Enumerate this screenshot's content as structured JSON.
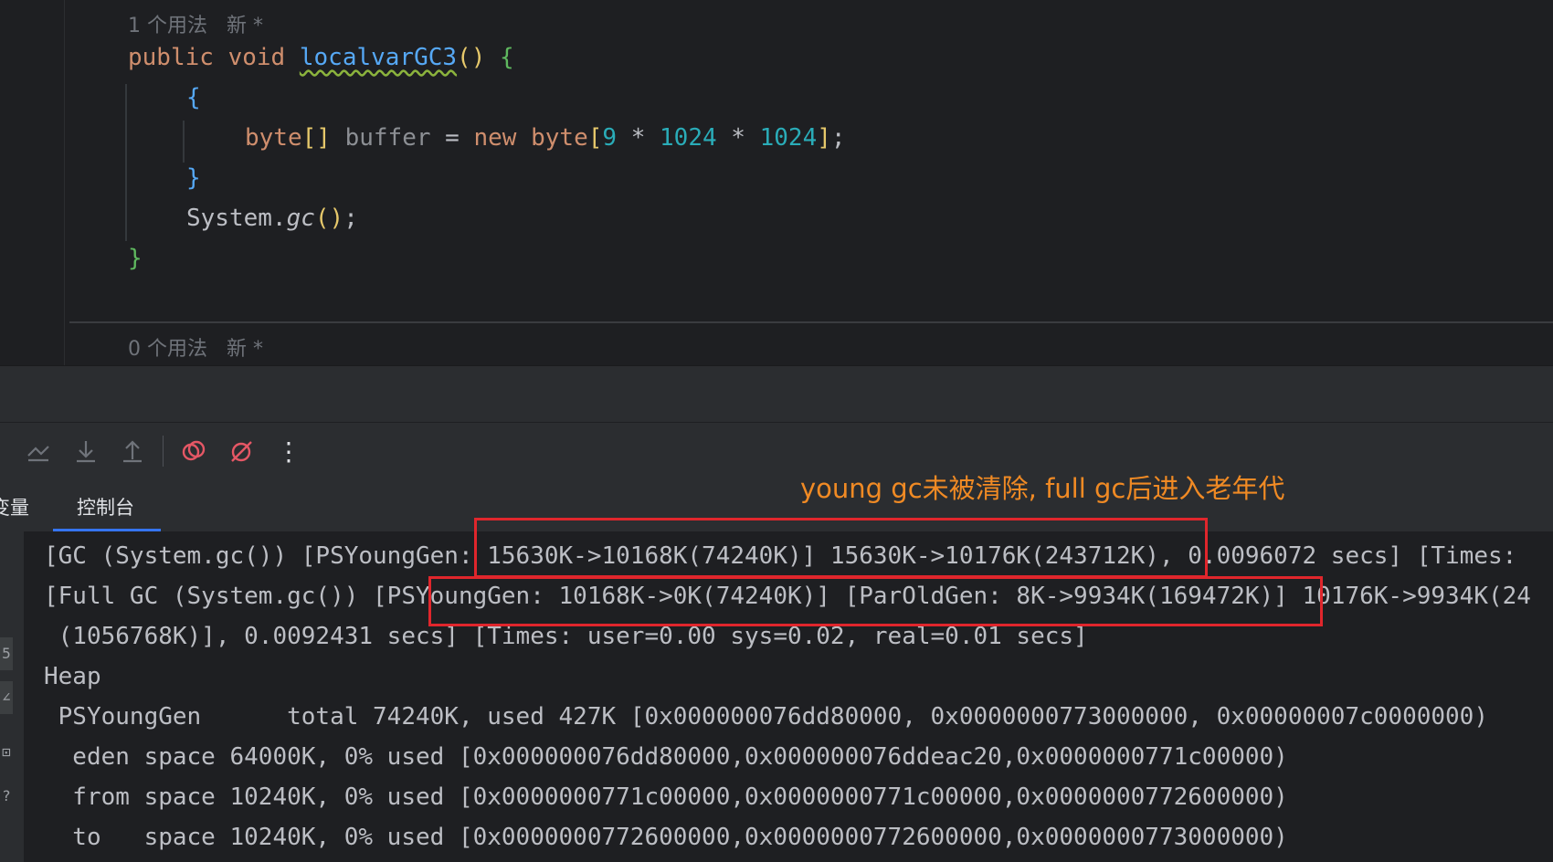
{
  "editor": {
    "usages_top": "1 个用法   新 *",
    "method_decl": {
      "kw1": "public",
      "kw2": "void",
      "name": "localvarGC3",
      "parens": "()",
      "brace": "{"
    },
    "block_open": "{",
    "stmt": {
      "type": "byte",
      "arr": "[]",
      "var": "buffer",
      "eq": "=",
      "new": "new",
      "type2": "byte",
      "lb": "[",
      "n1": "9",
      "op1": "*",
      "n2": "1024",
      "op2": "*",
      "n3": "1024",
      "rb": "]",
      "semi": ";"
    },
    "block_close": "}",
    "gc_call": {
      "cls": "System.",
      "method": "gc",
      "parens": "()",
      "semi": ";"
    },
    "method_close": "}",
    "usages_bottom": "0 个用法   新 *"
  },
  "toolbar": {
    "icons": [
      "soft-wrap-icon",
      "scroll-down-icon",
      "scroll-up-icon",
      "restart-icon",
      "stop-icon",
      "more-icon"
    ],
    "more": "⋮"
  },
  "tabs": [
    {
      "label": "变量"
    },
    {
      "label": "控制台"
    }
  ],
  "annotation": "young gc未被清除, full gc后进入老年代",
  "console": {
    "lines": [
      "[GC (System.gc()) [PSYoungGen: 15630K->10168K(74240K)] 15630K->10176K(243712K), 0.0096072 secs] [Times:",
      "[Full GC (System.gc()) [PSYoungGen: 10168K->0K(74240K)] [ParOldGen: 8K->9934K(169472K)] 10176K->9934K(24",
      " (1056768K)], 0.0092431 secs] [Times: user=0.00 sys=0.02, real=0.01 secs]",
      "Heap",
      " PSYoungGen      total 74240K, used 427K [0x000000076dd80000, 0x0000000773000000, 0x00000007c0000000)",
      "  eden space 64000K, 0% used [0x000000076dd80000,0x000000076ddeac20,0x0000000771c00000)",
      "  from space 10240K, 0% used [0x0000000771c00000,0x0000000771c00000,0x0000000772600000)",
      "  to   space 10240K, 0% used [0x0000000772600000,0x0000000772600000,0x0000000773000000)"
    ],
    "gutter_tags": [
      "5",
      "∠",
      "⊡",
      "?"
    ]
  },
  "colors": {
    "keyword": "#cf8e6d",
    "method": "#56a8f5",
    "number": "#2aacb8",
    "annotation": "#f08a24",
    "highlight_box": "#e0262c",
    "tab_underline": "#3574f0"
  }
}
